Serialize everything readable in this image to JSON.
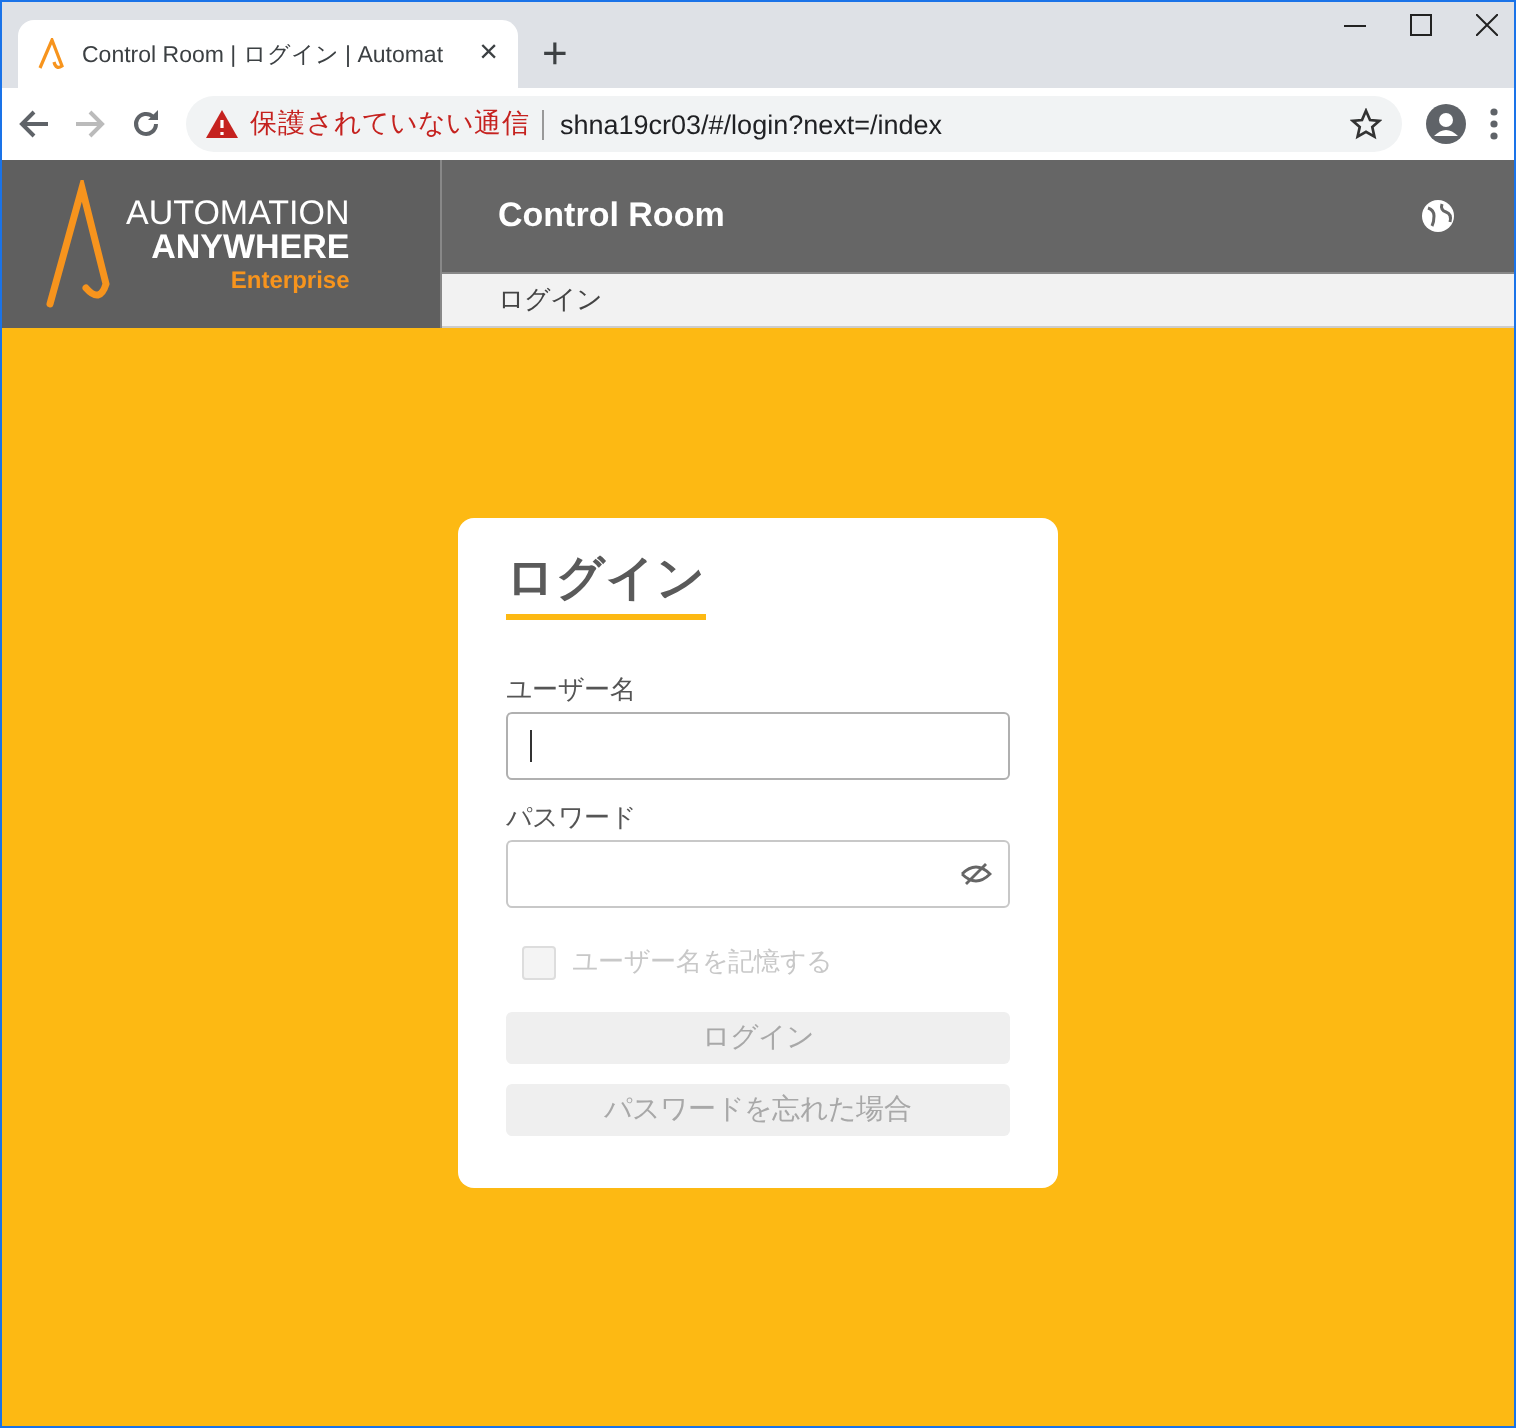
{
  "browser": {
    "tab": {
      "title": "Control Room | ログイン | Automat",
      "close": "×"
    },
    "new_tab": "+",
    "security_warning": "保護されていない通信",
    "url": "shna19cr03/#/login?next=/index"
  },
  "app": {
    "logo": {
      "line1": "AUTOMATION",
      "line2": "ANYWHERE",
      "line3": "Enterprise"
    },
    "title": "Control Room",
    "breadcrumb": "ログイン"
  },
  "login": {
    "title": "ログイン",
    "fields": [
      {
        "label": "ユーザー名",
        "kind": "text",
        "focused": true
      },
      {
        "label": "パスワード",
        "kind": "password",
        "focused": false
      }
    ],
    "remember": {
      "label": "ユーザー名を記憶する",
      "checked": false,
      "disabled": true
    },
    "buttons": [
      {
        "label": "ログイン",
        "disabled": true
      },
      {
        "label": "パスワードを忘れた場合",
        "disabled": true
      }
    ]
  }
}
